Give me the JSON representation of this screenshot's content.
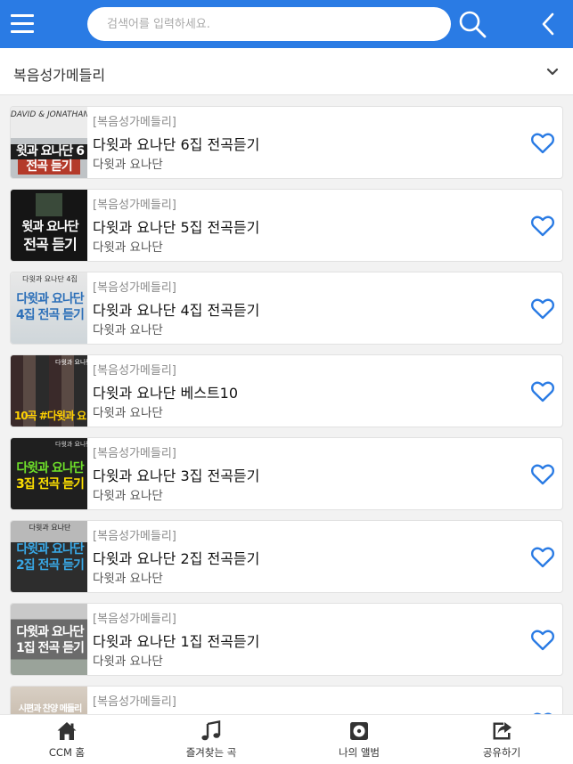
{
  "header": {
    "search_placeholder": "검색어를 입력하세요.",
    "menu_icon": "hamburger-menu-icon",
    "search_icon": "search-icon",
    "back_icon": "chevron-left-icon",
    "color": "#2a7be4"
  },
  "category": {
    "label": "복음성가메들리",
    "dropdown_icon": "chevron-down-icon"
  },
  "items": [
    {
      "category": "[복음성가메들리]",
      "title": "다윗과 요나단 6집 전곡듣기",
      "artist": "다윗과 요나단",
      "favorite_icon": "heart-outline-icon",
      "thumb": {
        "top": "DAVID & JONATHAN",
        "main": "윗과 요나단 6",
        "sub": "전곡 듣기"
      }
    },
    {
      "category": "[복음성가메들리]",
      "title": "다윗과 요나단 5집 전곡듣기",
      "artist": "다윗과 요나단",
      "favorite_icon": "heart-outline-icon",
      "thumb": {
        "main": "윗과 요나단",
        "sub": "전곡 듣기"
      }
    },
    {
      "category": "[복음성가메들리]",
      "title": "다윗과 요나단 4집 전곡듣기",
      "artist": "다윗과 요나단",
      "favorite_icon": "heart-outline-icon",
      "thumb": {
        "top": "다윗과 요나단 4집",
        "main": "다윗과 요나단",
        "sub": "4집 전곡 듣기"
      }
    },
    {
      "category": "[복음성가메들리]",
      "title": "다윗과 요나단 베스트10",
      "artist": "다윗과 요나단",
      "favorite_icon": "heart-outline-icon",
      "thumb": {
        "top": "다윗과 요나단",
        "sub": "10곡 #다윗과 요"
      }
    },
    {
      "category": "[복음성가메들리]",
      "title": "다윗과 요나단 3집 전곡듣기",
      "artist": "다윗과 요나단",
      "favorite_icon": "heart-outline-icon",
      "thumb": {
        "top": "다윗과 요나단",
        "main": "다윗과 요나단",
        "sub": "3집 전곡 듣기"
      }
    },
    {
      "category": "[복음성가메들리]",
      "title": "다윗과 요나단 2집 전곡듣기",
      "artist": "다윗과 요나단",
      "favorite_icon": "heart-outline-icon",
      "thumb": {
        "top": "다윗과 요나단",
        "main": "다윗과 요나단",
        "sub": "2집 전곡 듣기"
      }
    },
    {
      "category": "[복음성가메들리]",
      "title": "다윗과 요나단 1집 전곡듣기",
      "artist": "다윗과 요나단",
      "favorite_icon": "heart-outline-icon",
      "thumb": {
        "main": "다윗과 요나단",
        "sub": "1집 전곡 듣기"
      }
    },
    {
      "category": "[복음성가메들리]",
      "title": "",
      "artist": "",
      "favorite_icon": "heart-outline-icon",
      "thumb": {
        "main": "시편과 찬양 메들리"
      }
    }
  ],
  "bottom_nav": [
    {
      "label": "CCM 홈",
      "icon": "home-icon"
    },
    {
      "label": "즐겨찾는 곡",
      "icon": "music-note-icon"
    },
    {
      "label": "나의 앨범",
      "icon": "album-icon"
    },
    {
      "label": "공유하기",
      "icon": "share-icon"
    }
  ]
}
